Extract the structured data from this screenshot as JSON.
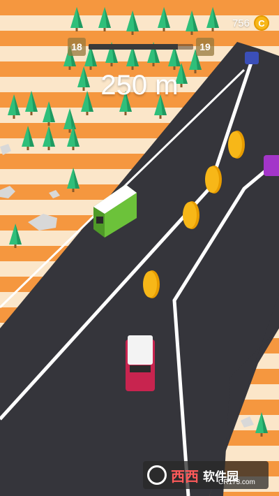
{
  "hud": {
    "coin_count": "756",
    "coin_symbol": "C",
    "level_current": "18",
    "level_next": "19",
    "level_progress": 0.85,
    "distance": "250 m"
  },
  "watermark": {
    "brand": "西西",
    "name": "软件园",
    "url": "CR173.com"
  },
  "colors": {
    "road": "#35353b",
    "lane_line": "#ffffff",
    "stripe_orange": "#f5973f",
    "stripe_cream": "#fbe6c9",
    "tree": "#2fbf7a",
    "coin": "#f7b718",
    "bus_body": "#6cc23a",
    "player_car": "#c8244f",
    "purple_car": "#a335c9",
    "blue_car": "#3b4fb8"
  },
  "icons": [
    "coin-icon",
    "tree-icon",
    "rock-icon",
    "bus-icon",
    "car-icon"
  ]
}
